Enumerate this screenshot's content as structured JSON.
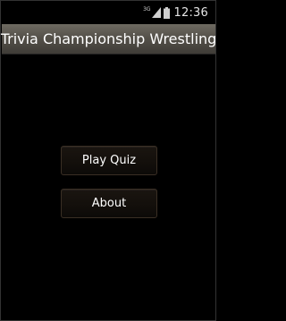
{
  "status_bar": {
    "network_type": "3G",
    "time": "12:36",
    "icons": [
      "signal-icon",
      "battery-icon"
    ]
  },
  "app": {
    "title": "Trivia Championship Wrestling"
  },
  "buttons": {
    "play_quiz_label": "Play Quiz",
    "about_label": "About"
  },
  "colors": {
    "background": "#000000",
    "title_bar": "#55514a",
    "button_bg": "#130f0b",
    "button_border": "#3a2f24",
    "text": "#ffffff"
  }
}
